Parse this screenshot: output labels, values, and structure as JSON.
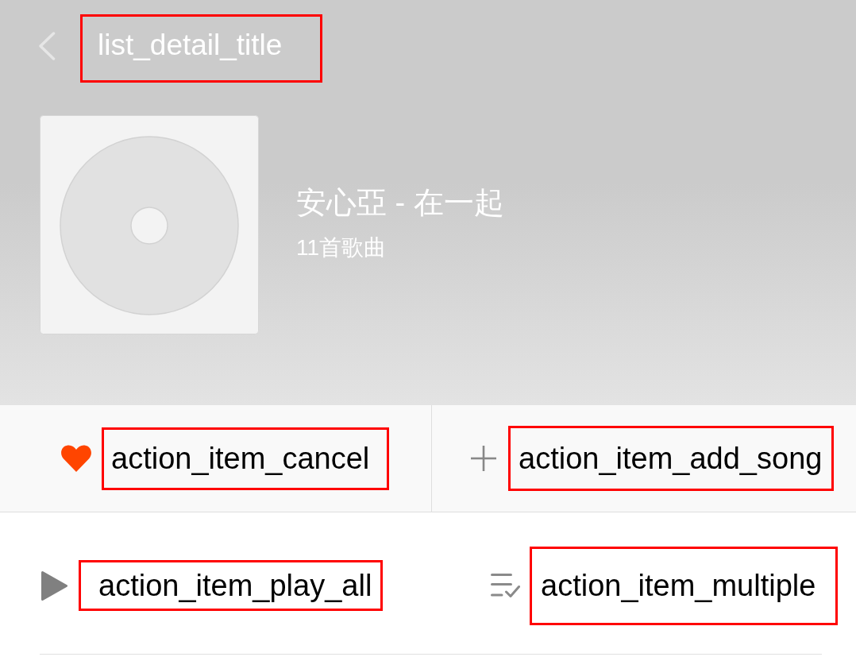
{
  "header": {
    "title": "list_detail_title"
  },
  "album": {
    "title": "安心亞 - 在一起",
    "song_count": "11首歌曲"
  },
  "action_bar": {
    "items": [
      {
        "kind": "favorite",
        "label": "action_item_cancel"
      },
      {
        "kind": "add_song",
        "label": "action_item_add_song"
      }
    ]
  },
  "list_controls": {
    "items": [
      {
        "kind": "play_all",
        "label": "action_item_play_all"
      },
      {
        "kind": "multiple",
        "label": "action_item_multiple"
      }
    ]
  }
}
